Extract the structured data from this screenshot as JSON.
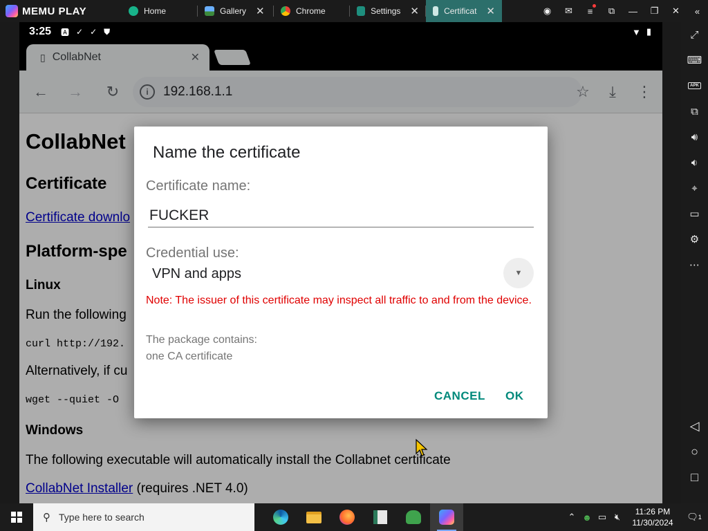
{
  "emulator": {
    "brand": "MEMU PLAY",
    "tabs": [
      {
        "label": "Home",
        "icon": "home-app-icon",
        "active": false
      },
      {
        "label": "Gallery",
        "icon": "gallery-icon",
        "active": false
      },
      {
        "label": "Chrome",
        "icon": "chrome-icon",
        "active": false
      },
      {
        "label": "Settings",
        "icon": "settings-gear-icon",
        "active": false
      },
      {
        "label": "Certificat",
        "icon": "certificate-installer-icon",
        "active": true
      }
    ],
    "accent_color": "#2c6f6b"
  },
  "android": {
    "status_bar": {
      "time": "3:25"
    },
    "browser": {
      "tab_title": "CollabNet",
      "url": "192.168.1.1"
    },
    "page": {
      "title": "CollabNet",
      "h_certificate": "Certificate",
      "cert_link": "Certificate downlo",
      "h_platform": "Platform-spe",
      "h_linux": "Linux",
      "linux_text": "Run the following",
      "linux_cmd1": "curl http://192.",
      "linux_alt": "Alternatively, if cu",
      "linux_cmd2": "wget --quiet -O",
      "h_windows": "Windows",
      "windows_text": "The following executable will automatically install the Collabnet certificate",
      "installer_link": "CollabNet Installer",
      "installer_note": " (requires .NET 4.0)"
    },
    "dialog": {
      "title": "Name the certificate",
      "name_label": "Certificate name:",
      "name_value": "FUCKER",
      "credential_label": "Credential use:",
      "credential_value": "VPN and apps",
      "warning": "Note: The issuer of this certificate may inspect all traffic to and from the device.",
      "package_label": "The package contains:",
      "package_value": "one CA certificate",
      "cancel_label": "CANCEL",
      "ok_label": "OK",
      "button_color": "#00897b",
      "warning_color": "#e00000"
    }
  },
  "taskbar": {
    "search_placeholder": "Type here to search",
    "clock_time": "11:26 PM",
    "clock_date": "11/30/2024",
    "notification_count": "1"
  }
}
